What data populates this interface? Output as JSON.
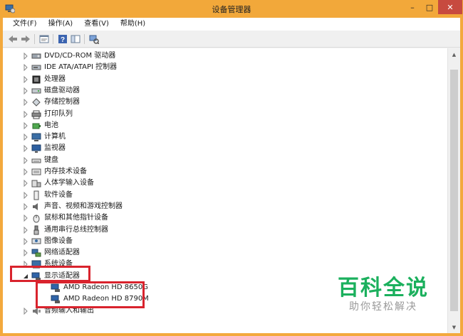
{
  "window": {
    "title": "设备管理器",
    "min_glyph": "–",
    "max_glyph": "□",
    "close_glyph": "✕"
  },
  "menubar": {
    "items": [
      "文件(F)",
      "操作(A)",
      "查看(V)",
      "帮助(H)"
    ]
  },
  "toolbar": {
    "buttons": [
      "back-arrow-icon",
      "forward-arrow-icon",
      "properties-icon",
      "help-icon",
      "show-hide-icon",
      "scan-hardware-icon"
    ]
  },
  "tree": {
    "items": [
      {
        "label": "DVD/CD-ROM 驱动器",
        "expanded": false,
        "icon": "dvd-drive-icon"
      },
      {
        "label": "IDE ATA/ATAPI 控制器",
        "expanded": false,
        "icon": "ide-controller-icon"
      },
      {
        "label": "处理器",
        "expanded": false,
        "icon": "processor-icon"
      },
      {
        "label": "磁盘驱动器",
        "expanded": false,
        "icon": "disk-drive-icon"
      },
      {
        "label": "存储控制器",
        "expanded": false,
        "icon": "storage-controller-icon"
      },
      {
        "label": "打印队列",
        "expanded": false,
        "icon": "printer-icon"
      },
      {
        "label": "电池",
        "expanded": false,
        "icon": "battery-icon"
      },
      {
        "label": "计算机",
        "expanded": false,
        "icon": "computer-icon"
      },
      {
        "label": "监视器",
        "expanded": false,
        "icon": "monitor-icon"
      },
      {
        "label": "键盘",
        "expanded": false,
        "icon": "keyboard-icon"
      },
      {
        "label": "内存技术设备",
        "expanded": false,
        "icon": "memory-device-icon"
      },
      {
        "label": "人体学输入设备",
        "expanded": false,
        "icon": "hid-icon"
      },
      {
        "label": "软件设备",
        "expanded": false,
        "icon": "software-device-icon"
      },
      {
        "label": "声音、视频和游戏控制器",
        "expanded": false,
        "icon": "sound-icon"
      },
      {
        "label": "鼠标和其他指针设备",
        "expanded": false,
        "icon": "mouse-icon"
      },
      {
        "label": "通用串行总线控制器",
        "expanded": false,
        "icon": "usb-icon"
      },
      {
        "label": "图像设备",
        "expanded": false,
        "icon": "imaging-device-icon"
      },
      {
        "label": "网络适配器",
        "expanded": false,
        "icon": "network-adapter-icon"
      },
      {
        "label": "系统设备",
        "expanded": false,
        "icon": "system-device-icon"
      },
      {
        "label": "显示适配器",
        "expanded": true,
        "icon": "display-adapter-icon"
      },
      {
        "label": "AMD Radeon HD 8650G",
        "child": true,
        "icon": "display-adapter-icon"
      },
      {
        "label": "AMD Radeon HD 8790M",
        "child": true,
        "icon": "display-adapter-icon"
      },
      {
        "label": "音频输入和输出",
        "expanded": false,
        "icon": "audio-io-icon"
      }
    ]
  },
  "watermark": {
    "title": "百科全说",
    "subtitle": "助你轻松解决"
  },
  "colors": {
    "titlebar": "#f2a83a",
    "close": "#c74a3f",
    "highlight": "#d9232d",
    "watermark": "#1bb05d"
  }
}
